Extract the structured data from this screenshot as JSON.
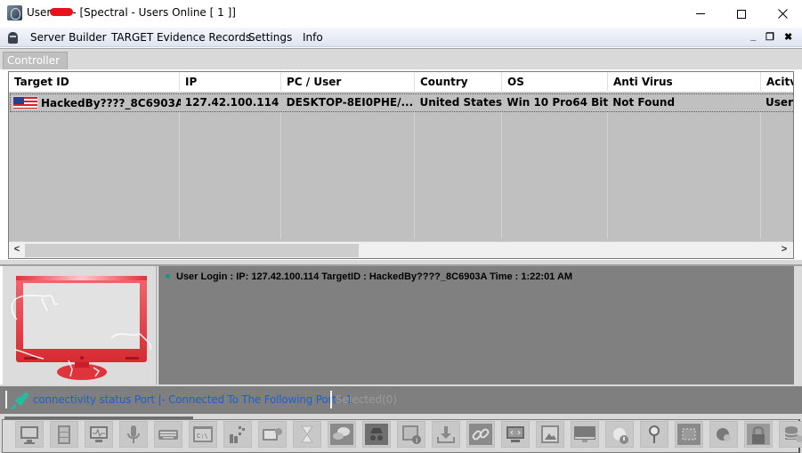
{
  "window": {
    "title_prefix": "User",
    "title_suffix": "- [Spectral - Users Online [ 1 ]]",
    "minimize_label": "minimize",
    "maximize_label": "maximize",
    "close_label": "close"
  },
  "menu": {
    "items": [
      {
        "label": "Server Builder"
      },
      {
        "label": "TARGET Evidence Records"
      },
      {
        "label": "Settings"
      },
      {
        "label": "Info"
      }
    ],
    "mdi_controls": {
      "minimize": "_",
      "restore": "❐",
      "close": "✖"
    }
  },
  "tabs": [
    {
      "label": "Controller",
      "active": true
    }
  ],
  "grid": {
    "columns": [
      "Target ID",
      "IP",
      "PC / User",
      "Country",
      "OS",
      "Anti Virus",
      "Acitv"
    ],
    "rows": [
      {
        "flag": "united-states-flag-icon",
        "target_id": "HackedBy????_8C6903A",
        "ip": "127.42.100.114",
        "pc_user": "DESKTOP-8EI0PHE/...",
        "country": "United States",
        "os": "Win 10 Pro64 Bit",
        "anti_virus": "Not Found",
        "activity": "User"
      }
    ],
    "scroll_left": "<",
    "scroll_right": ">"
  },
  "log": {
    "entries": [
      {
        "text": "User Login : IP: 127.42.100.114 TargetID : HackedBy????_8C6903A Time : 1:22:01 AM"
      }
    ]
  },
  "status": {
    "connection_text": "connectivity status Port |- Connected To The Following Port : 1",
    "selected_text": "Selected(0)",
    "connection_color": "#1f5fd0"
  },
  "toolbar": {
    "buttons": [
      {
        "icon": "remote-desktop-icon"
      },
      {
        "icon": "file-manager-icon"
      },
      {
        "icon": "system-monitor-icon"
      },
      {
        "icon": "microphone-icon"
      },
      {
        "icon": "keyboard-icon"
      },
      {
        "icon": "command-prompt-icon"
      },
      {
        "icon": "processes-icon"
      },
      {
        "icon": "remote-settings-icon"
      },
      {
        "icon": "hourglass-icon"
      },
      {
        "icon": "chat-icon"
      },
      {
        "icon": "spy-icon"
      },
      {
        "icon": "system-info-icon"
      },
      {
        "icon": "download-icon"
      },
      {
        "icon": "link-icon"
      },
      {
        "icon": "remote-code-icon"
      },
      {
        "icon": "image-icon"
      },
      {
        "icon": "screen-icon"
      },
      {
        "icon": "alert-icon"
      },
      {
        "icon": "search-icon"
      },
      {
        "icon": "chip-icon"
      },
      {
        "icon": "network-settings-icon"
      },
      {
        "icon": "lock-icon"
      },
      {
        "icon": "database-settings-icon"
      }
    ]
  }
}
